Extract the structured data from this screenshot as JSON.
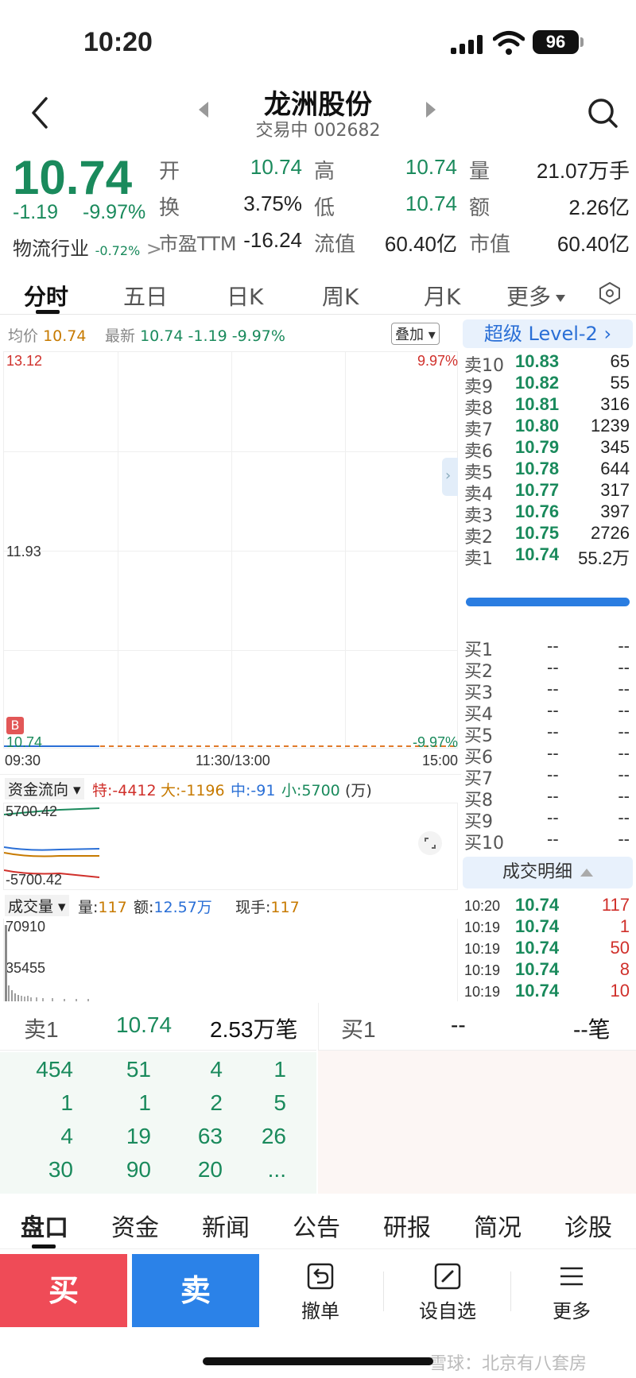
{
  "status_bar": {
    "time": "10:20",
    "battery": "96"
  },
  "header": {
    "name": "龙洲股份",
    "sub": "交易中 002682"
  },
  "quote": {
    "price": "10.74",
    "change": "-1.19",
    "change_pct": "-9.97%",
    "industry": "物流行业",
    "industry_pct": "-0.72%",
    "rows": [
      [
        {
          "label": "开",
          "value": "10.74"
        },
        {
          "label": "高",
          "value": "10.74"
        },
        {
          "label": "量",
          "value": "21.07万手"
        }
      ],
      [
        {
          "label": "换",
          "value": "3.75%"
        },
        {
          "label": "低",
          "value": "10.74"
        },
        {
          "label": "额",
          "value": "2.26亿"
        }
      ],
      [
        {
          "label": "市盈TTM",
          "value": "-16.24"
        },
        {
          "label": "流值",
          "value": "60.40亿"
        },
        {
          "label": "市值",
          "value": "60.40亿"
        }
      ]
    ]
  },
  "tabs": {
    "items": [
      "分时",
      "五日",
      "日K",
      "周K",
      "月K",
      "更多"
    ]
  },
  "chart": {
    "avg_label": "均价",
    "avg_value": "10.74",
    "latest_label": "最新",
    "latest_value": "10.74",
    "latest_change": "-1.19",
    "latest_pct": "-9.97%",
    "overlay_label": "叠加",
    "y_top": "13.12",
    "y_mid": "11.93",
    "y_bottom": "10.74",
    "pct_top": "9.97%",
    "pct_bottom": "-9.97%",
    "x_start": "09:30",
    "x_mid": "11:30/13:00",
    "x_end": "15:00",
    "marker": "B"
  },
  "chart_data": [
    {
      "type": "line",
      "title": "分时",
      "x": [
        "09:30",
        "11:30/13:00",
        "15:00"
      ],
      "ylim": [
        10.74,
        13.12
      ],
      "series": [
        {
          "name": "均价",
          "values": [
            10.74,
            10.74
          ]
        },
        {
          "name": "最新",
          "values": [
            10.74,
            10.74
          ]
        }
      ]
    }
  ],
  "fund_flow": {
    "label": "资金流向",
    "special": "特:-4412",
    "large": "大:-1196",
    "medium": "中:-91",
    "small": "小:5700",
    "unit": "(万)",
    "y_top": "5700.42",
    "y_bottom": "-5700.42"
  },
  "volume": {
    "label": "成交量",
    "vol_label": "量:",
    "vol": "117",
    "amt_label": "额:",
    "amt": "12.57万",
    "now_label": "现手:",
    "now": "117",
    "y_top": "70910",
    "y_mid": "35455"
  },
  "level2": {
    "banner": "超级 Level-2",
    "asks": [
      {
        "label": "卖10",
        "price": "10.83",
        "vol": "65"
      },
      {
        "label": "卖9",
        "price": "10.82",
        "vol": "55"
      },
      {
        "label": "卖8",
        "price": "10.81",
        "vol": "316"
      },
      {
        "label": "卖7",
        "price": "10.80",
        "vol": "1239"
      },
      {
        "label": "卖6",
        "price": "10.79",
        "vol": "345"
      },
      {
        "label": "卖5",
        "price": "10.78",
        "vol": "644"
      },
      {
        "label": "卖4",
        "price": "10.77",
        "vol": "317"
      },
      {
        "label": "卖3",
        "price": "10.76",
        "vol": "397"
      },
      {
        "label": "卖2",
        "price": "10.75",
        "vol": "2726"
      },
      {
        "label": "卖1",
        "price": "10.74",
        "vol": "55.2万"
      }
    ],
    "bids": [
      {
        "label": "买1",
        "price": "--",
        "vol": "--"
      },
      {
        "label": "买2",
        "price": "--",
        "vol": "--"
      },
      {
        "label": "买3",
        "price": "--",
        "vol": "--"
      },
      {
        "label": "买4",
        "price": "--",
        "vol": "--"
      },
      {
        "label": "买5",
        "price": "--",
        "vol": "--"
      },
      {
        "label": "买6",
        "price": "--",
        "vol": "--"
      },
      {
        "label": "买7",
        "price": "--",
        "vol": "--"
      },
      {
        "label": "买8",
        "price": "--",
        "vol": "--"
      },
      {
        "label": "买9",
        "price": "--",
        "vol": "--"
      },
      {
        "label": "买10",
        "price": "--",
        "vol": "--"
      }
    ],
    "detail_label": "成交明细",
    "trades": [
      {
        "time": "10:20",
        "price": "10.74",
        "vol": "117"
      },
      {
        "time": "10:19",
        "price": "10.74",
        "vol": "1"
      },
      {
        "time": "10:19",
        "price": "10.74",
        "vol": "50"
      },
      {
        "time": "10:19",
        "price": "10.74",
        "vol": "8"
      },
      {
        "time": "10:19",
        "price": "10.74",
        "vol": "10"
      }
    ]
  },
  "order_book": {
    "sell_label": "卖1",
    "sell_price": "10.74",
    "sell_count": "2.53万笔",
    "buy_label": "买1",
    "buy_price": "--",
    "buy_count": "--笔",
    "grid": [
      [
        "454",
        "51",
        "4",
        "1"
      ],
      [
        "1",
        "1",
        "2",
        "5"
      ],
      [
        "4",
        "19",
        "63",
        "26"
      ],
      [
        "30",
        "90",
        "20",
        "..."
      ]
    ]
  },
  "bottom_tabs": [
    "盘口",
    "资金",
    "新闻",
    "公告",
    "研报",
    "简况",
    "诊股"
  ],
  "actions": {
    "buy": "买",
    "sell": "卖",
    "cancel": "撤单",
    "watchlist": "设自选",
    "more": "更多"
  },
  "watermark": "雪球：北京有八套房",
  "colors": {
    "up": "#d0302b",
    "down": "#1a8a5c",
    "accent": "#2a6fd6",
    "buy": "#ef4b57",
    "sell": "#2b82e8"
  }
}
